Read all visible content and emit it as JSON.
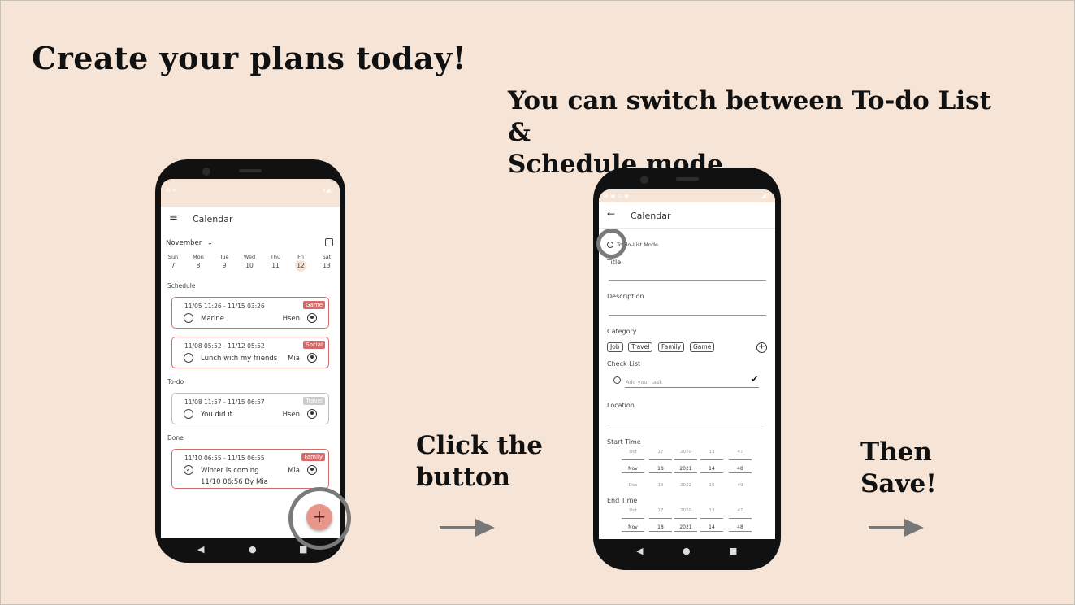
{
  "slide": {
    "heading": "Create your plans today!",
    "subheading_line1": "You can switch between To-do List &",
    "subheading_line2": "Schedule mode",
    "caption1_line1": "Click the",
    "caption1_line2": "button",
    "caption2_line1": "Then",
    "caption2_line2": "Save!"
  },
  "colors": {
    "background": "#f6e5d7",
    "accent": "#d46b6b",
    "fab": "#e8958a"
  },
  "phone1": {
    "app_title": "Calendar",
    "month": "November",
    "week": [
      {
        "day": "Sun",
        "date": "7"
      },
      {
        "day": "Mon",
        "date": "8"
      },
      {
        "day": "Tue",
        "date": "9"
      },
      {
        "day": "Wed",
        "date": "10"
      },
      {
        "day": "Thu",
        "date": "11"
      },
      {
        "day": "Fri",
        "date": "12"
      },
      {
        "day": "Sat",
        "date": "13"
      }
    ],
    "section_schedule": "Schedule",
    "section_todo": "To-do",
    "section_done": "Done",
    "cards": [
      {
        "time": "11/05 11:26  -  11/15 03:26",
        "tag": "Game",
        "title": "Marine",
        "who": "Hsen"
      },
      {
        "time": "11/08 05:52  -  11/12 05:52",
        "tag": "Social",
        "title": "Lunch with my friends",
        "who": "Mia"
      },
      {
        "time": "11/08 11:57  -  11/15 06:57",
        "tag": "Travel",
        "title": "You did it",
        "who": "Hsen"
      },
      {
        "time": "11/10 06:55  -  11/15 06:55",
        "tag": "Family",
        "title": "Winter is coming",
        "who": "Mia",
        "extra": "11/10 06:56 By Mia"
      }
    ],
    "fab_label": "+"
  },
  "phone2": {
    "app_title": "Calendar",
    "mode_label": "To-do-List Mode",
    "title_label": "Title",
    "description_label": "Description",
    "category_label": "Category",
    "categories": [
      "Job",
      "Travel",
      "Family",
      "Game"
    ],
    "checklist_label": "Check List",
    "task_placeholder": "Add your task",
    "location_label": "Location",
    "start_time_label": "Start Time",
    "end_time_label": "End Time",
    "picker_prev": [
      "Oct",
      "17",
      "2020",
      "13",
      "47"
    ],
    "picker_selected": [
      "Nov",
      "18",
      "2021",
      "14",
      "48"
    ],
    "picker_next": [
      "Dec",
      "19",
      "2022",
      "15",
      "49"
    ]
  },
  "nav": {
    "back": "◀",
    "home": "●",
    "recent": "■"
  }
}
